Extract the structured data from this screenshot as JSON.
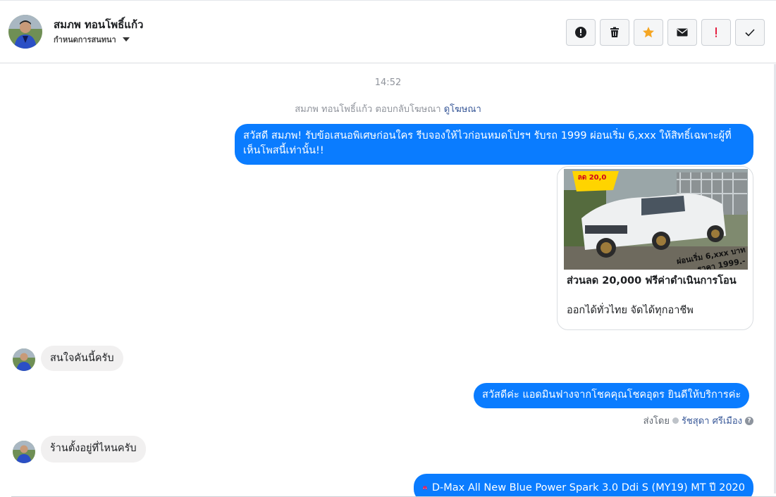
{
  "header": {
    "contact_name": "สมภพ ทอนโพธิ์แก้ว",
    "assign_label": "กำหนดการสนทนา",
    "actions": [
      {
        "name": "report-spam-icon",
        "color": "#1c1e21"
      },
      {
        "name": "trash-icon",
        "color": "#1c1e21"
      },
      {
        "name": "star-icon",
        "color": "#f5a623"
      },
      {
        "name": "envelope-icon",
        "color": "#1c1e21"
      },
      {
        "name": "exclamation-icon",
        "color": "#e41e3f"
      },
      {
        "name": "checkmark-icon",
        "color": "#1c1e21"
      }
    ]
  },
  "thread": {
    "timestamp": "14:52",
    "ad_reply_prefix": "สมภพ ทอนโพธิ์แก้ว ตอบกลับโฆษณา",
    "ad_reply_link": "ดูโฆษณา",
    "messages": {
      "m1_line1": "สวัสดี สมภพ! รับข้อเสนอพิเศษก่อนใคร รีบจองให้ไวก่อนหมดโปรฯ รับรถ 1999 ผ่อนเริ่ม 6,xxx ให้สิทธิ์เฉพาะผู้ที่",
      "m1_line2": "เห็นโพสนี้เท่านั้น!!",
      "card_title": "ส่วนลด 20,000 ฟรีค่าดำเนินการโอน",
      "card_subtitle": "ออกได้ทั่วไทย จัดได้ทุกอาชีพ",
      "card_banner_top": "ลด 20,0",
      "card_banner_bottom": "ผ่อนเริ่ม 6,xxx บาท",
      "card_banner_bottom2": "ราคา 1999.-",
      "in1": "สนใจคันนี้ครับ",
      "m2": "สวัสดีค่ะ แอดมินฟางจากโชคคุณโชคอุดร ยินดีให้บริการค่ะ",
      "sent_by_label": "ส่งโดย",
      "sent_by_name": "รัชสุดา ศรีเมือง",
      "in2": "ร้านตั้งอยู่ที่ไหนครับ",
      "m3": "D-Max All New Blue Power Spark 3.0 Ddi S (MY19) MT ปี 2020"
    }
  },
  "colors": {
    "accent": "#0a7cff",
    "incoming_bubble": "#f1f0f0",
    "link": "#385898"
  }
}
